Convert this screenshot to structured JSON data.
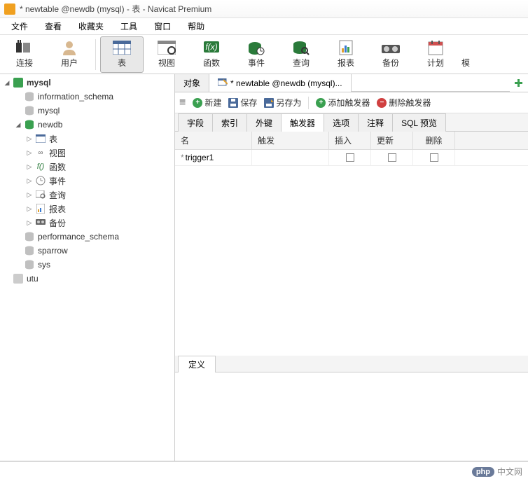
{
  "window": {
    "title": "* newtable @newdb (mysql) - 表 - Navicat Premium"
  },
  "menu": [
    "文件",
    "查看",
    "收藏夹",
    "工具",
    "窗口",
    "帮助"
  ],
  "toolbar": [
    {
      "id": "connection",
      "label": "连接"
    },
    {
      "id": "user",
      "label": "用户"
    },
    {
      "id": "table",
      "label": "表",
      "active": true
    },
    {
      "id": "view",
      "label": "视图"
    },
    {
      "id": "function",
      "label": "函数"
    },
    {
      "id": "event",
      "label": "事件"
    },
    {
      "id": "query",
      "label": "查询"
    },
    {
      "id": "report",
      "label": "报表"
    },
    {
      "id": "backup",
      "label": "备份"
    },
    {
      "id": "schedule",
      "label": "计划"
    },
    {
      "id": "model",
      "label": "模"
    }
  ],
  "tree": [
    {
      "label": "mysql",
      "type": "connection",
      "indent": 0,
      "expanded": true,
      "icon": "conn-green"
    },
    {
      "label": "information_schema",
      "type": "db",
      "indent": 1,
      "icon": "db"
    },
    {
      "label": "mysql",
      "type": "db",
      "indent": 1,
      "icon": "db"
    },
    {
      "label": "newdb",
      "type": "db",
      "indent": 1,
      "expanded": true,
      "icon": "db-open"
    },
    {
      "label": "表",
      "type": "folder",
      "indent": 2,
      "icon": "table",
      "hasChildren": true
    },
    {
      "label": "视图",
      "type": "folder",
      "indent": 2,
      "icon": "view",
      "hasChildren": true
    },
    {
      "label": "函数",
      "type": "folder",
      "indent": 2,
      "icon": "func",
      "hasChildren": true
    },
    {
      "label": "事件",
      "type": "folder",
      "indent": 2,
      "icon": "event",
      "hasChildren": true
    },
    {
      "label": "查询",
      "type": "folder",
      "indent": 2,
      "icon": "query",
      "hasChildren": true
    },
    {
      "label": "报表",
      "type": "folder",
      "indent": 2,
      "icon": "report",
      "hasChildren": true
    },
    {
      "label": "备份",
      "type": "folder",
      "indent": 2,
      "icon": "backup",
      "hasChildren": true
    },
    {
      "label": "performance_schema",
      "type": "db",
      "indent": 1,
      "icon": "db"
    },
    {
      "label": "sparrow",
      "type": "db",
      "indent": 1,
      "icon": "db"
    },
    {
      "label": "sys",
      "type": "db",
      "indent": 1,
      "icon": "db"
    },
    {
      "label": "utu",
      "type": "connection",
      "indent": 0,
      "icon": "conn-gray"
    }
  ],
  "tabs": {
    "items": [
      {
        "label": "对象",
        "active": false
      },
      {
        "label": "* newtable @newdb (mysql)...",
        "active": true
      }
    ]
  },
  "actions": {
    "new": "新建",
    "save": "保存",
    "saveas": "另存为",
    "addTrigger": "添加触发器",
    "delTrigger": "删除触发器"
  },
  "subtabs": [
    "字段",
    "索引",
    "外键",
    "触发器",
    "选项",
    "注释",
    "SQL 预览"
  ],
  "subtab_active": "触发器",
  "grid": {
    "headers": {
      "name": "名",
      "trigger": "触发",
      "insert": "插入",
      "update": "更新",
      "delete": "删除"
    },
    "rows": [
      {
        "name": "trigger1",
        "trigger": "",
        "insert": false,
        "update": false,
        "delete": false,
        "current": true
      }
    ]
  },
  "bottom": {
    "tab": "定义"
  },
  "footer": {
    "brand_prefix": "php",
    "brand_suffix": "中文网"
  }
}
